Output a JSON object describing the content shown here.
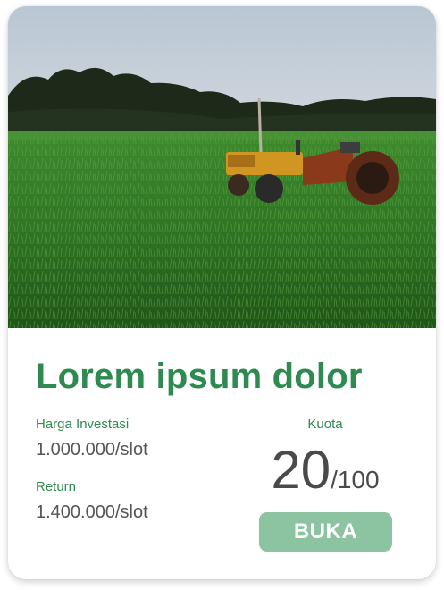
{
  "card": {
    "image_alt": "orange tractor in green grass field",
    "title": "Lorem ipsum dolor",
    "investment_label": "Harga Investasi",
    "investment_value": "1.000.000/slot",
    "return_label": "Return",
    "return_value": "1.400.000/slot",
    "quota_label": "Kuota",
    "quota_filled": "20",
    "quota_total": "/100",
    "button_label": "BUKA"
  },
  "colors": {
    "accent_green": "#2f8a4f",
    "button_bg": "#8cc3a0",
    "value_gray": "#555555"
  }
}
